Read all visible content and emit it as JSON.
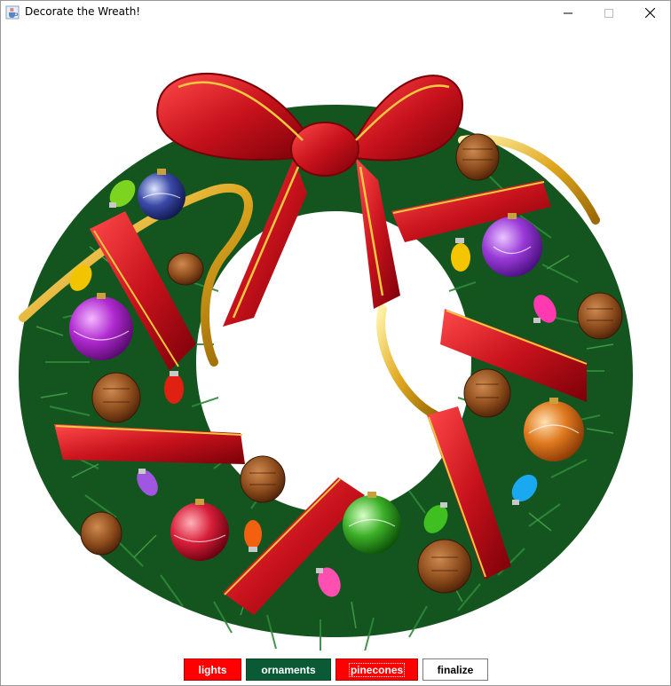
{
  "window": {
    "title": "Decorate the Wreath!",
    "controls": [
      "minimize",
      "maximize",
      "close"
    ]
  },
  "icons": {
    "app": "java-cup-icon",
    "minimize": "minimize-icon",
    "maximize": "maximize-icon",
    "close": "close-icon"
  },
  "image": {
    "subject": "wreath",
    "decorations": [
      "bow",
      "ribbon",
      "ornaments",
      "lights",
      "pinecones"
    ]
  },
  "buttons": {
    "lights": "lights",
    "ornaments": "ornaments",
    "pinecones": "pinecones",
    "finalize": "finalize"
  },
  "colors": {
    "lights_bg": "#ff0000",
    "ornaments_bg": "#0a5a35",
    "pinecones_bg": "#ff0000",
    "finalize_bg": "#ffffff",
    "wreath_green": "#1f6b2a",
    "ribbon_red": "#d3141c",
    "gold": "#e6b422"
  }
}
